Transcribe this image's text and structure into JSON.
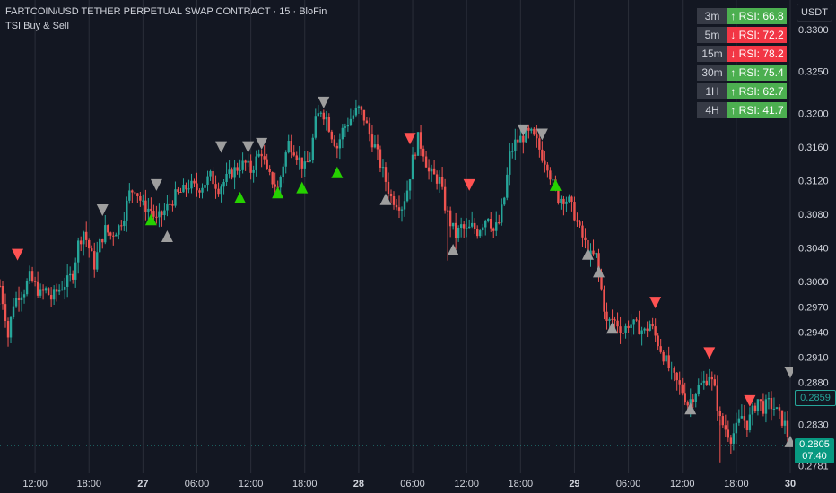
{
  "header": {
    "title": "FARTCOIN/USD TETHER PERPETUAL SWAP CONTRACT · 15 · BloFin",
    "indicator": "TSI Buy & Sell"
  },
  "price_axis": {
    "unit": "USDT",
    "marked_price": "0.2859",
    "current_price": "0.2805",
    "countdown": "07:40"
  },
  "rsi_table": [
    {
      "tf": "3m",
      "text": "↑ RSI: 66.8",
      "color": "#4caf50"
    },
    {
      "tf": "5m",
      "text": "↓ RSI: 72.2",
      "color": "#f23645"
    },
    {
      "tf": "15m",
      "text": "↓ RSI: 78.2",
      "color": "#f23645"
    },
    {
      "tf": "30m",
      "text": "↑ RSI: 75.4",
      "color": "#4caf50"
    },
    {
      "tf": "1H",
      "text": "↑ RSI: 62.7",
      "color": "#4caf50"
    },
    {
      "tf": "4H",
      "text": "↑ RSI: 41.7",
      "color": "#4caf50"
    }
  ],
  "colors": {
    "background": "#131722",
    "bull": "#26a69a",
    "bear": "#ef5350",
    "grid": "#2a2e39",
    "buy_signal": "#26d100",
    "sell_signal": "#ff5252",
    "neutral_signal": "#9e9e9e"
  },
  "chart_data": {
    "type": "candlestick",
    "y_ticks": [
      "0.3300",
      "0.3250",
      "0.3200",
      "0.3160",
      "0.3120",
      "0.3080",
      "0.3040",
      "0.3000",
      "0.2970",
      "0.2940",
      "0.2910",
      "0.2880",
      "0.2830",
      "0.2781"
    ],
    "x_ticks": [
      "12:00",
      "18:00",
      "27",
      "06:00",
      "12:00",
      "18:00",
      "28",
      "06:00",
      "12:00",
      "18:00",
      "29",
      "06:00",
      "12:00",
      "18:00",
      "30"
    ],
    "x_tick_positions": [
      1.5,
      3.5,
      5.5,
      7.5,
      9.5,
      11.5,
      13.5,
      15.5,
      17.5,
      19.5,
      21.5,
      23.5,
      25.5,
      27.5,
      29.5
    ],
    "x_range": [
      0.2,
      29.6
    ],
    "ylim": [
      0.2772,
      0.3335
    ],
    "close_path": [
      [
        0.2,
        0.2995
      ],
      [
        0.4,
        0.296
      ],
      [
        0.5,
        0.2935
      ],
      [
        0.7,
        0.2975
      ],
      [
        0.9,
        0.2985
      ],
      [
        1.1,
        0.299
      ],
      [
        1.3,
        0.3005
      ],
      [
        1.5,
        0.2995
      ],
      [
        1.7,
        0.2985
      ],
      [
        1.9,
        0.299
      ],
      [
        2.1,
        0.298
      ],
      [
        2.3,
        0.2988
      ],
      [
        2.5,
        0.2995
      ],
      [
        2.7,
        0.3
      ],
      [
        2.9,
        0.301
      ],
      [
        3.1,
        0.3045
      ],
      [
        3.3,
        0.306
      ],
      [
        3.5,
        0.304
      ],
      [
        3.7,
        0.302
      ],
      [
        3.9,
        0.3045
      ],
      [
        4.1,
        0.3062
      ],
      [
        4.3,
        0.3055
      ],
      [
        4.6,
        0.3065
      ],
      [
        4.8,
        0.308
      ],
      [
        5.0,
        0.3105
      ],
      [
        5.2,
        0.3112
      ],
      [
        5.5,
        0.309
      ],
      [
        5.8,
        0.3085
      ],
      [
        6.0,
        0.3072
      ],
      [
        6.2,
        0.308
      ],
      [
        6.4,
        0.3088
      ],
      [
        6.7,
        0.3102
      ],
      [
        7.0,
        0.3108
      ],
      [
        7.2,
        0.3115
      ],
      [
        7.5,
        0.311
      ],
      [
        7.8,
        0.3118
      ],
      [
        8.0,
        0.3125
      ],
      [
        8.3,
        0.3112
      ],
      [
        8.6,
        0.3122
      ],
      [
        8.8,
        0.313
      ],
      [
        9.1,
        0.3138
      ],
      [
        9.3,
        0.314
      ],
      [
        9.5,
        0.3132
      ],
      [
        9.7,
        0.3145
      ],
      [
        9.9,
        0.3155
      ],
      [
        10.1,
        0.3128
      ],
      [
        10.3,
        0.312
      ],
      [
        10.5,
        0.311
      ],
      [
        10.7,
        0.314
      ],
      [
        10.9,
        0.3165
      ],
      [
        11.1,
        0.3158
      ],
      [
        11.3,
        0.3145
      ],
      [
        11.5,
        0.3135
      ],
      [
        11.7,
        0.3148
      ],
      [
        11.9,
        0.319
      ],
      [
        12.1,
        0.3205
      ],
      [
        12.3,
        0.3195
      ],
      [
        12.5,
        0.3175
      ],
      [
        12.7,
        0.316
      ],
      [
        12.9,
        0.318
      ],
      [
        13.1,
        0.319
      ],
      [
        13.3,
        0.3198
      ],
      [
        13.5,
        0.3205
      ],
      [
        13.7,
        0.3195
      ],
      [
        13.9,
        0.3175
      ],
      [
        14.1,
        0.316
      ],
      [
        14.3,
        0.314
      ],
      [
        14.5,
        0.312
      ],
      [
        14.7,
        0.31
      ],
      [
        14.9,
        0.3095
      ],
      [
        15.1,
        0.309
      ],
      [
        15.3,
        0.311
      ],
      [
        15.5,
        0.3145
      ],
      [
        15.7,
        0.317
      ],
      [
        15.9,
        0.3155
      ],
      [
        16.1,
        0.313
      ],
      [
        16.3,
        0.3125
      ],
      [
        16.5,
        0.312
      ],
      [
        16.7,
        0.309
      ],
      [
        16.9,
        0.307
      ],
      [
        17.1,
        0.3055
      ],
      [
        17.3,
        0.3065
      ],
      [
        17.5,
        0.306
      ],
      [
        17.7,
        0.3065
      ],
      [
        17.9,
        0.306
      ],
      [
        18.1,
        0.307
      ],
      [
        18.3,
        0.308
      ],
      [
        18.5,
        0.306
      ],
      [
        18.7,
        0.307
      ],
      [
        18.9,
        0.31
      ],
      [
        19.1,
        0.315
      ],
      [
        19.3,
        0.3165
      ],
      [
        19.5,
        0.317
      ],
      [
        19.7,
        0.3175
      ],
      [
        19.9,
        0.3175
      ],
      [
        20.1,
        0.3165
      ],
      [
        20.3,
        0.315
      ],
      [
        20.5,
        0.314
      ],
      [
        20.7,
        0.3115
      ],
      [
        20.9,
        0.31
      ],
      [
        21.1,
        0.31
      ],
      [
        21.3,
        0.3095
      ],
      [
        21.5,
        0.308
      ],
      [
        21.7,
        0.306
      ],
      [
        21.9,
        0.3045
      ],
      [
        22.1,
        0.303
      ],
      [
        22.3,
        0.303
      ],
      [
        22.5,
        0.299
      ],
      [
        22.7,
        0.295
      ],
      [
        22.9,
        0.2955
      ],
      [
        23.1,
        0.295
      ],
      [
        23.3,
        0.294
      ],
      [
        23.5,
        0.295
      ],
      [
        23.7,
        0.2948
      ],
      [
        23.9,
        0.2945
      ],
      [
        24.1,
        0.294
      ],
      [
        24.3,
        0.295
      ],
      [
        24.5,
        0.2935
      ],
      [
        24.7,
        0.292
      ],
      [
        24.9,
        0.2905
      ],
      [
        25.1,
        0.289
      ],
      [
        25.3,
        0.288
      ],
      [
        25.5,
        0.287
      ],
      [
        25.7,
        0.2855
      ],
      [
        25.9,
        0.2865
      ],
      [
        26.1,
        0.2875
      ],
      [
        26.3,
        0.288
      ],
      [
        26.5,
        0.289
      ],
      [
        26.7,
        0.287
      ],
      [
        26.9,
        0.2835
      ],
      [
        27.1,
        0.2825
      ],
      [
        27.3,
        0.2815
      ],
      [
        27.5,
        0.2825
      ],
      [
        27.7,
        0.284
      ],
      [
        27.9,
        0.283
      ],
      [
        28.1,
        0.2845
      ],
      [
        28.3,
        0.286
      ],
      [
        28.5,
        0.285
      ],
      [
        28.7,
        0.2855
      ],
      [
        28.9,
        0.285
      ],
      [
        29.1,
        0.284
      ],
      [
        29.3,
        0.283
      ],
      [
        29.5,
        0.2805
      ]
    ],
    "buy_signals": [
      [
        5.8,
        0.3074
      ],
      [
        9.1,
        0.31
      ],
      [
        10.5,
        0.3106
      ],
      [
        11.4,
        0.3112
      ],
      [
        12.7,
        0.313
      ],
      [
        20.8,
        0.3115
      ]
    ],
    "sell_signals": [
      [
        0.85,
        0.3032
      ],
      [
        15.4,
        0.317
      ],
      [
        17.6,
        0.3115
      ],
      [
        24.5,
        0.2975
      ],
      [
        26.5,
        0.2915
      ],
      [
        28.0,
        0.2858
      ]
    ],
    "neutral_up": [
      [
        0.0,
        0.298
      ],
      [
        6.4,
        0.3054
      ],
      [
        14.5,
        0.3098
      ],
      [
        17.0,
        0.3038
      ],
      [
        22.0,
        0.3033
      ],
      [
        22.4,
        0.3012
      ],
      [
        22.9,
        0.2945
      ],
      [
        25.8,
        0.2849
      ],
      [
        29.5,
        0.281
      ]
    ],
    "neutral_down": [
      [
        4.0,
        0.3085
      ],
      [
        6.0,
        0.3115
      ],
      [
        8.4,
        0.316
      ],
      [
        9.4,
        0.316
      ],
      [
        9.9,
        0.3164
      ],
      [
        12.2,
        0.3213
      ],
      [
        19.6,
        0.318
      ],
      [
        20.3,
        0.3175
      ],
      [
        29.5,
        0.2892
      ]
    ],
    "extra_wicks": [
      [
        16.8,
        0.3025
      ],
      [
        26.9,
        0.2785
      ]
    ]
  }
}
